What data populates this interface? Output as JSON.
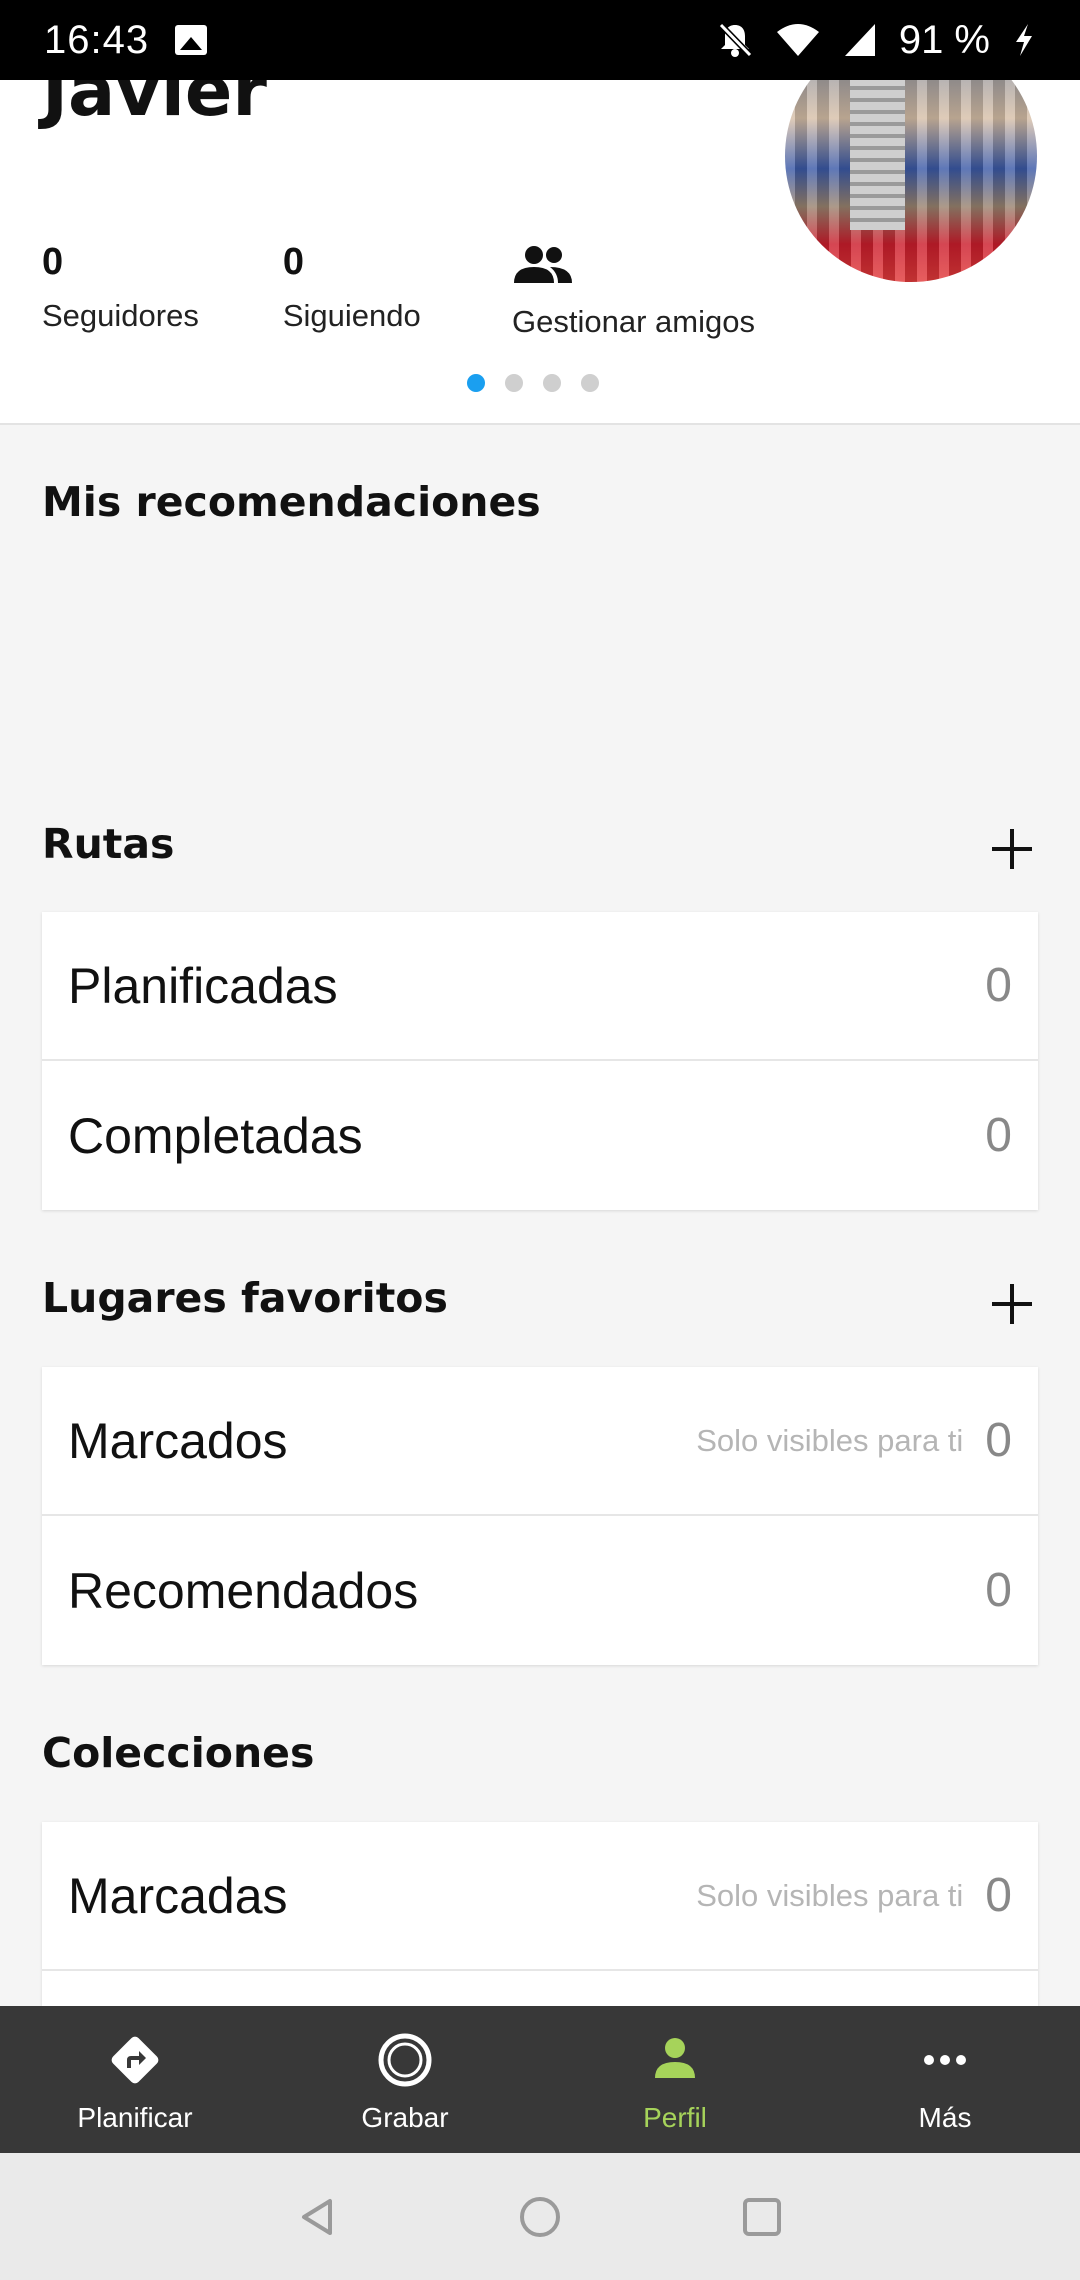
{
  "status_bar": {
    "time": "16:43",
    "battery": "91 %",
    "icons": [
      "image-icon",
      "bell-off-icon",
      "wifi-icon",
      "signal-icon",
      "charging-icon"
    ]
  },
  "profile": {
    "name": "Javier",
    "avatar_watermark": "www.real",
    "stats": [
      {
        "value": "0",
        "label": "Seguidores"
      },
      {
        "value": "0",
        "label": "Siguiendo"
      }
    ],
    "manage_friends_label": "Gestionar amigos",
    "pager": {
      "count": 4,
      "active": 1
    }
  },
  "recommendations": {
    "title": "Mis recomendaciones"
  },
  "routes": {
    "title": "Rutas",
    "rows": [
      {
        "label": "Planificadas",
        "count": "0"
      },
      {
        "label": "Completadas",
        "count": "0"
      }
    ]
  },
  "favorite_places": {
    "title": "Lugares favoritos",
    "rows": [
      {
        "label": "Marcados",
        "note": "Solo visibles para ti",
        "count": "0"
      },
      {
        "label": "Recomendados",
        "count": "0"
      }
    ]
  },
  "collections": {
    "title": "Colecciones",
    "rows": [
      {
        "label": "Marcadas",
        "note": "Solo visibles para ti",
        "count": "0"
      }
    ]
  },
  "bottom_nav": {
    "items": [
      {
        "label": "Planificar",
        "icon": "directions-icon"
      },
      {
        "label": "Grabar",
        "icon": "record-icon"
      },
      {
        "label": "Perfil",
        "icon": "person-icon",
        "active": true
      },
      {
        "label": "Más",
        "icon": "more-icon"
      }
    ],
    "active_color": "#a6d35a"
  },
  "colors": {
    "accent": "#1a9ff0",
    "nav_bg": "#383838"
  }
}
